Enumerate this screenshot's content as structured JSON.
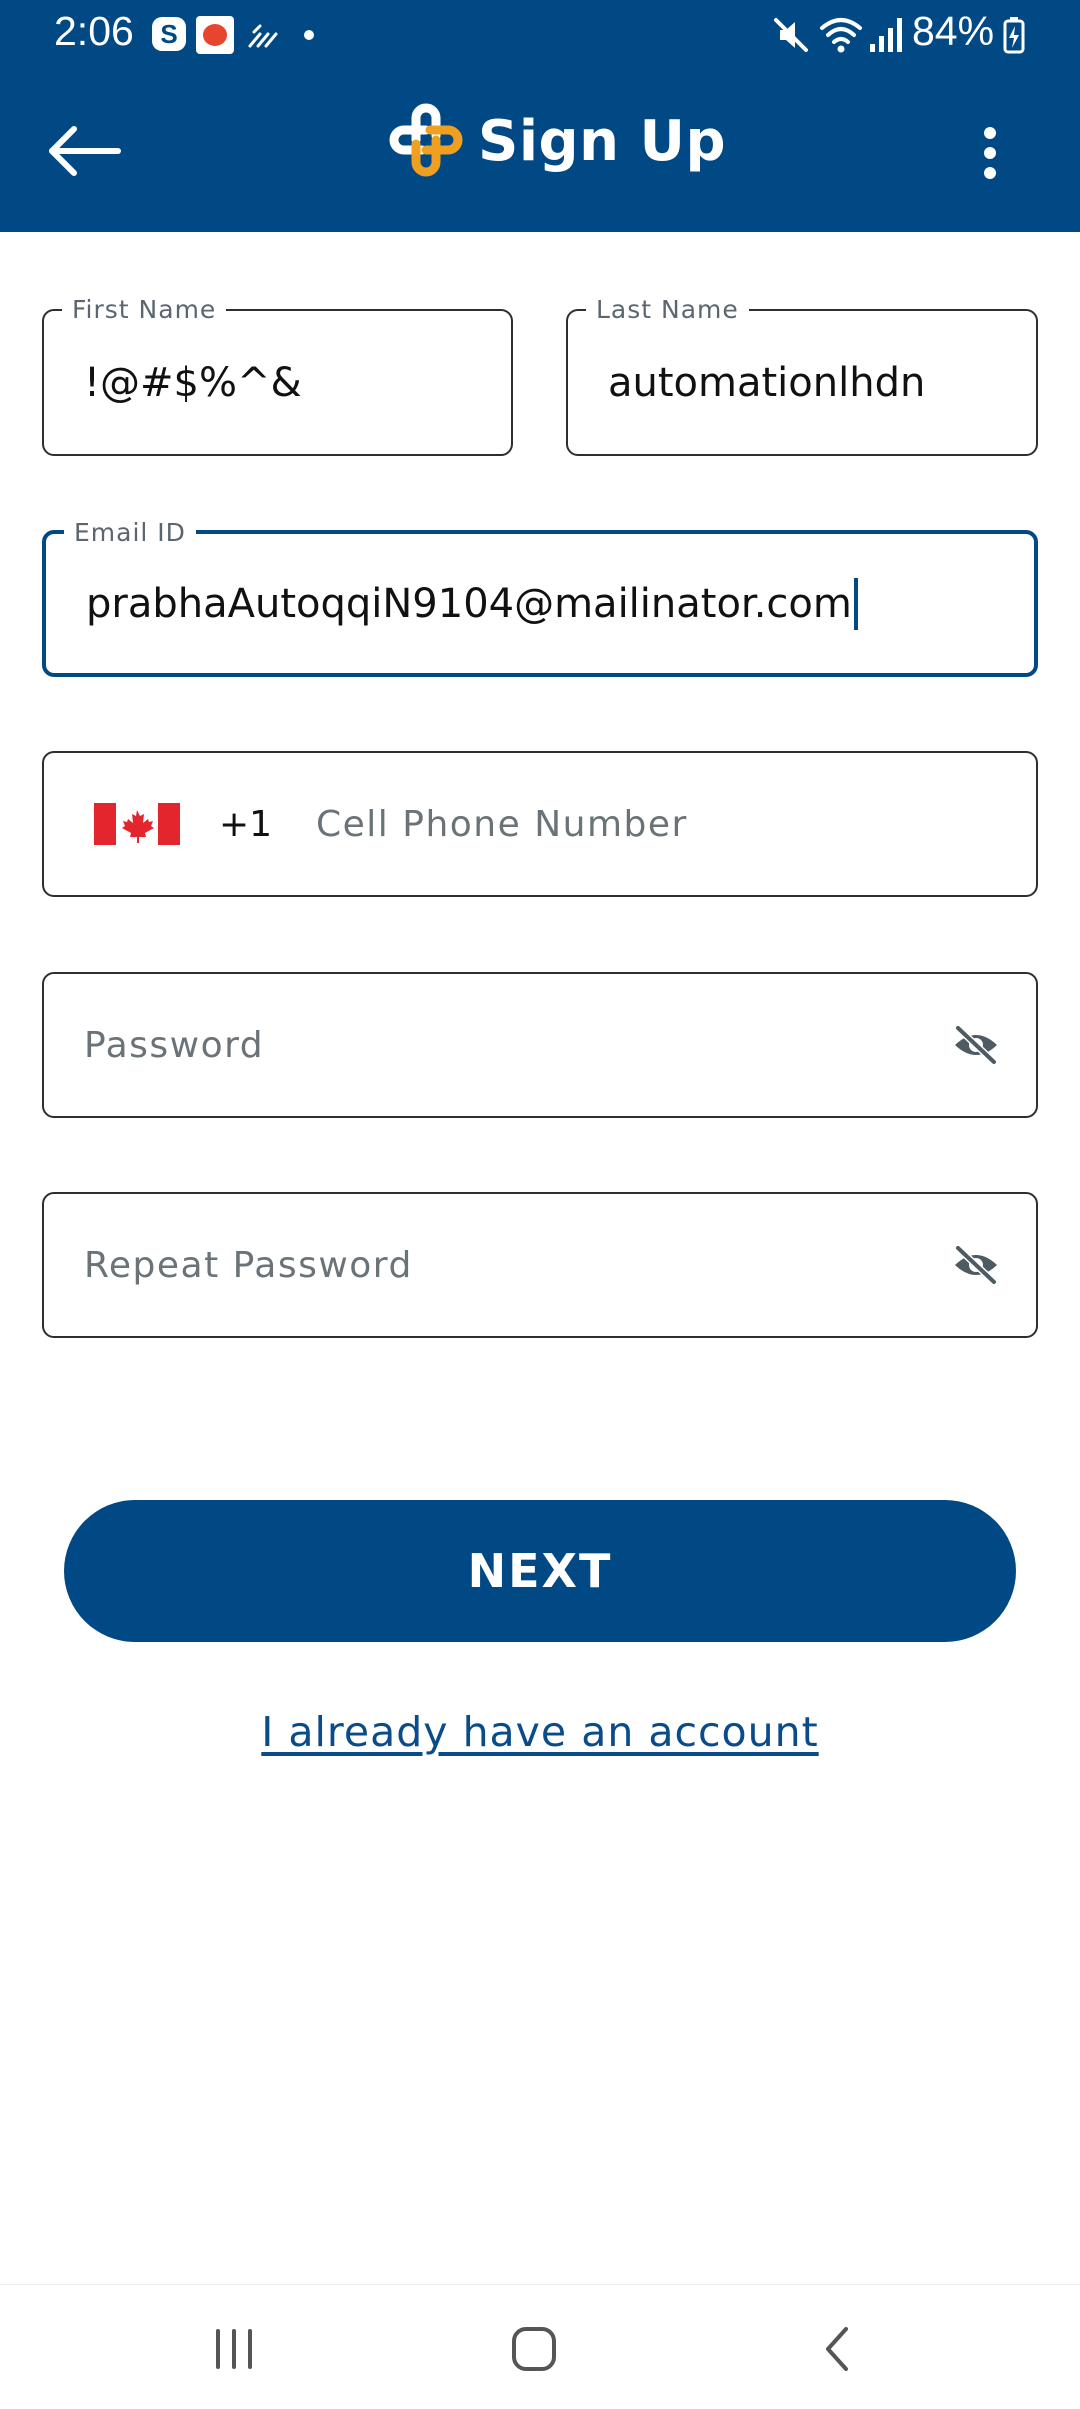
{
  "status_bar": {
    "time": "2:06",
    "s_icon_letter": "S",
    "battery": "84%"
  },
  "app_bar": {
    "title": "Sign Up"
  },
  "form": {
    "first_name": {
      "label": "First Name",
      "value": "!@#$%^&"
    },
    "last_name": {
      "label": "Last Name",
      "value": "automationlhdn"
    },
    "email": {
      "label": "Email ID",
      "value": "prabhaAutoqqiN9104@mailinator.com"
    },
    "phone": {
      "country_code": "+1",
      "placeholder": "Cell Phone Number",
      "flag_icon": "canada-flag-icon"
    },
    "password": {
      "placeholder": "Password"
    },
    "repeat_password": {
      "placeholder": "Repeat Password"
    }
  },
  "actions": {
    "next_label": "NEXT",
    "login_link": "I already have an account"
  },
  "colors": {
    "primary": "#004985",
    "logo_accent": "#f0a020",
    "border": "#2b2f33",
    "placeholder": "#6a7378"
  }
}
